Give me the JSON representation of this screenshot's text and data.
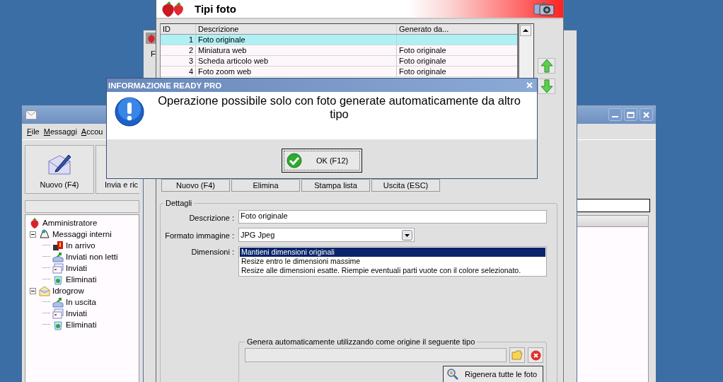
{
  "mail_window": {
    "menu": [
      {
        "label": "File"
      },
      {
        "label": "Messaggi"
      },
      {
        "label": "Accou"
      }
    ],
    "toolbar": [
      {
        "label": "Nuovo (F4)",
        "kind": "new"
      },
      {
        "label": "Invia e ric",
        "kind": "send"
      }
    ],
    "tree": [
      {
        "label": "Amministratore",
        "kind": "user",
        "children": [
          {
            "label": "Messaggi interni",
            "kind": "bell",
            "expanded": true,
            "children": [
              {
                "label": "In arrivo",
                "kind": "inbox"
              },
              {
                "label": "Inviati non letti",
                "kind": "outbox"
              },
              {
                "label": "Inviati",
                "kind": "sent"
              },
              {
                "label": "Eliminati",
                "kind": "trash"
              }
            ]
          },
          {
            "label": "Idrogrow",
            "kind": "account",
            "expanded": true,
            "children": [
              {
                "label": "In uscita",
                "kind": "outbox"
              },
              {
                "label": "Inviati",
                "kind": "sent"
              },
              {
                "label": "Eliminati",
                "kind": "trash"
              }
            ]
          }
        ]
      }
    ]
  },
  "back_window": {
    "label": "F"
  },
  "tipi_foto": {
    "title": "Tipi foto",
    "columns": [
      "ID",
      "Descrizione",
      "Generato da..."
    ],
    "rows": [
      {
        "id": "1",
        "description": "Foto originale",
        "selected": true
      },
      {
        "id": "2",
        "description": "Miniatura web",
        "generated_from": "Foto originale",
        "selected": false
      },
      {
        "id": "3",
        "description": "Scheda articolo web",
        "generated_from": "Foto originale",
        "selected": false
      },
      {
        "id": "4",
        "description": "Foto zoom web",
        "generated_from": "Foto originale",
        "selected": false
      }
    ],
    "buttons": [
      "Nuovo (F4)",
      "Elimina",
      "Stampa lista",
      "Uscita (ESC)"
    ],
    "details": {
      "title": "Dettagli",
      "description_label": "Descrizione :",
      "description_value": "Foto originale",
      "format_label": "Formato immagine :",
      "format_value": "JPG Jpeg",
      "dimensions_label": "Dimensioni :",
      "dimension_options": [
        {
          "label": "Mantieni dimensioni originali",
          "selected": true
        },
        {
          "label": "Resize entro le dimensioni massime",
          "selected": false
        },
        {
          "label": "Resize alle dimensioni esatte. Riempie eventuali parti vuote con il colore selezionato.",
          "selected": false
        }
      ],
      "auto_group": {
        "title": "Genera automaticamente utilizzando come origine il seguente tipo",
        "regenerate_button": "Rigenera tutte le foto"
      }
    }
  },
  "dialog": {
    "title": "INFORMAZIONE READY PRO",
    "message": "Operazione possibile solo con foto generate automaticamente da altro tipo",
    "ok_button": "OK (F12)"
  }
}
